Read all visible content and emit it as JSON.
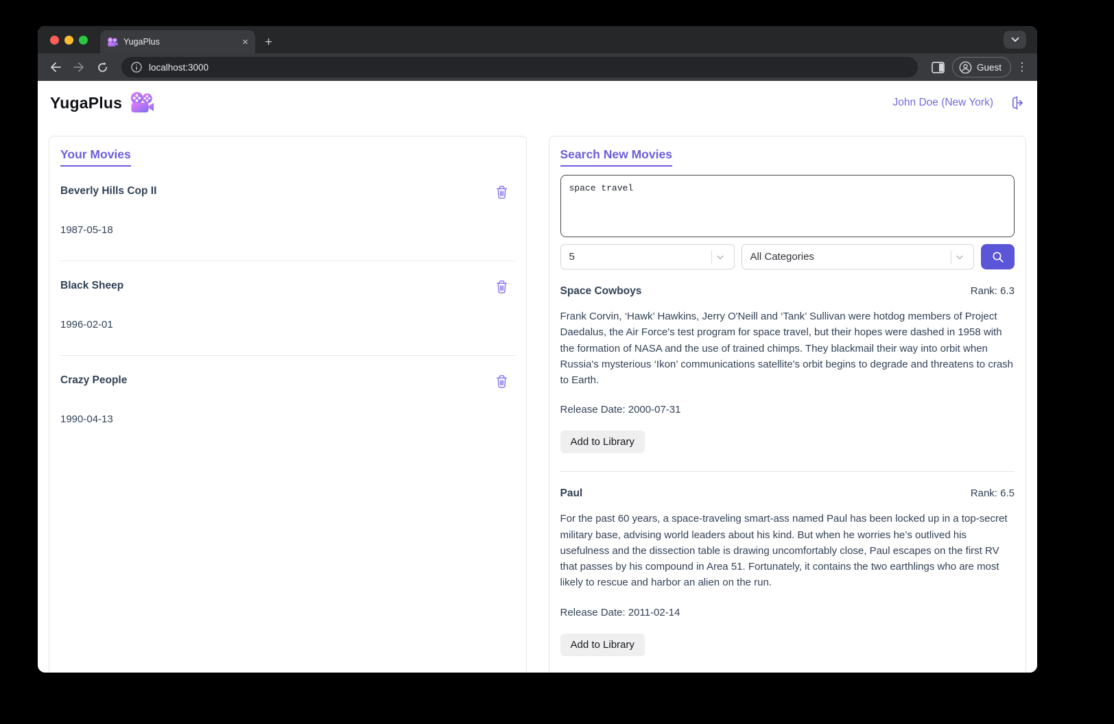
{
  "browser": {
    "tab_title": "YugaPlus",
    "url": "localhost:3000",
    "guest_label": "Guest",
    "glyphs": {
      "close": "×",
      "new_tab": "+",
      "kebab": "⋮"
    }
  },
  "header": {
    "brand": "YugaPlus",
    "user": "John Doe (New York)"
  },
  "library": {
    "title": "Your Movies",
    "movies": [
      {
        "title": "Beverly Hills Cop II",
        "date": "1987-05-18"
      },
      {
        "title": "Black Sheep",
        "date": "1996-02-01"
      },
      {
        "title": "Crazy People",
        "date": "1990-04-13"
      }
    ]
  },
  "search": {
    "title": "Search New Movies",
    "query": "space travel",
    "limit_value": "5",
    "category_value": "All Categories",
    "results": [
      {
        "title": "Space Cowboys",
        "rank_label": "Rank: 6.3",
        "description": "Frank Corvin, ‘Hawk’ Hawkins, Jerry O'Neill and ‘Tank’ Sullivan were hotdog members of Project Daedalus, the Air Force's test program for space travel, but their hopes were dashed in 1958 with the formation of NASA and the use of trained chimps. They blackmail their way into orbit when Russia's mysterious ‘Ikon’ communications satellite's orbit begins to degrade and threatens to crash to Earth.",
        "release_label": "Release Date: 2000-07-31",
        "action_label": "Add to Library"
      },
      {
        "title": "Paul",
        "rank_label": "Rank: 6.5",
        "description": "For the past 60 years, a space-traveling smart-ass named Paul has been locked up in a top-secret military base, advising world leaders about his kind. But when he worries he’s outlived his usefulness and the dissection table is drawing uncomfortably close, Paul escapes on the first RV that passes by his compound in Area 51. Fortunately, it contains the two earthlings who are most likely to rescue and harbor an alien on the run.",
        "release_label": "Release Date: 2011-02-14",
        "action_label": "Add to Library"
      }
    ]
  },
  "colors": {
    "accent": "#6d5ce0",
    "search_button": "#5b55d8",
    "body_text": "#324156",
    "trash_icon": "#8b7cf0"
  }
}
